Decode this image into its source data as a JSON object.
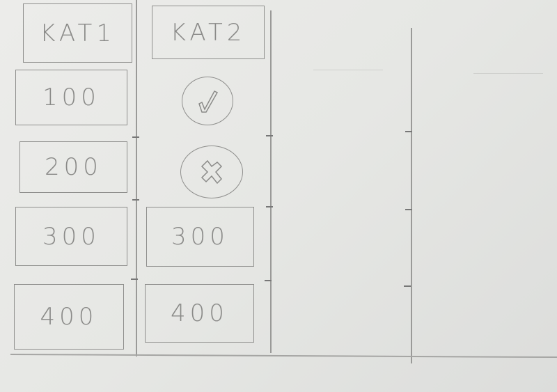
{
  "board": {
    "categories": [
      {
        "label": "KAT1",
        "cells": [
          {
            "type": "value",
            "label": "100"
          },
          {
            "type": "value",
            "label": "200"
          },
          {
            "type": "value",
            "label": "300"
          },
          {
            "type": "value",
            "label": "400"
          }
        ]
      },
      {
        "label": "KAT2",
        "cells": [
          {
            "type": "answered-correct",
            "icon": "check-icon"
          },
          {
            "type": "answered-wrong",
            "icon": "x-icon"
          },
          {
            "type": "value",
            "label": "300"
          },
          {
            "type": "value",
            "label": "400"
          }
        ]
      }
    ]
  }
}
